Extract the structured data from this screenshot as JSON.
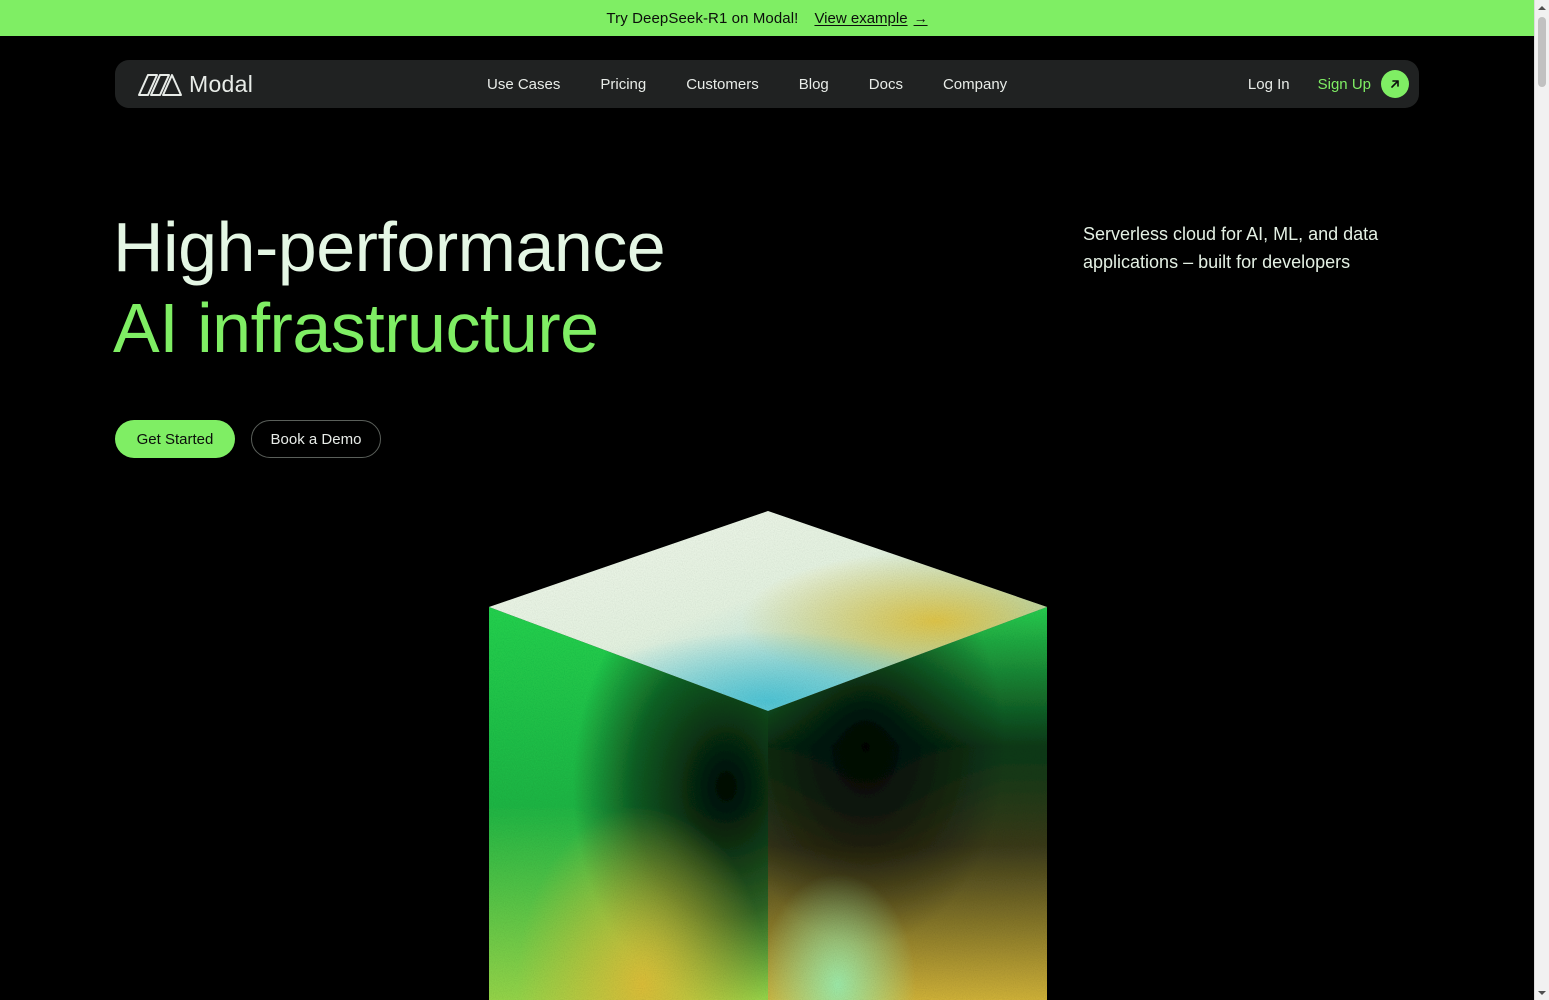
{
  "banner": {
    "text": "Try DeepSeek-R1 on Modal!",
    "link_label": "View example",
    "arrow": "→"
  },
  "nav": {
    "logo_text": "Modal",
    "links": [
      "Use Cases",
      "Pricing",
      "Customers",
      "Blog",
      "Docs",
      "Company"
    ],
    "login_label": "Log In",
    "signup_label": "Sign Up"
  },
  "hero": {
    "title_line1": "High-performance",
    "title_line2": "AI infrastructure",
    "subtitle": "Serverless cloud for AI, ML, and data applications – built for developers",
    "primary_button": "Get Started",
    "secondary_button": "Book a Demo"
  },
  "icons": {
    "logo": "modal-logo-icon",
    "signup": "arrow-up-right-icon",
    "banner_arrow": "arrow-right-icon"
  },
  "colors": {
    "accent": "#7FEE64",
    "background": "#000000",
    "nav_bg": "#202222",
    "text_light": "#E4F6E4"
  }
}
